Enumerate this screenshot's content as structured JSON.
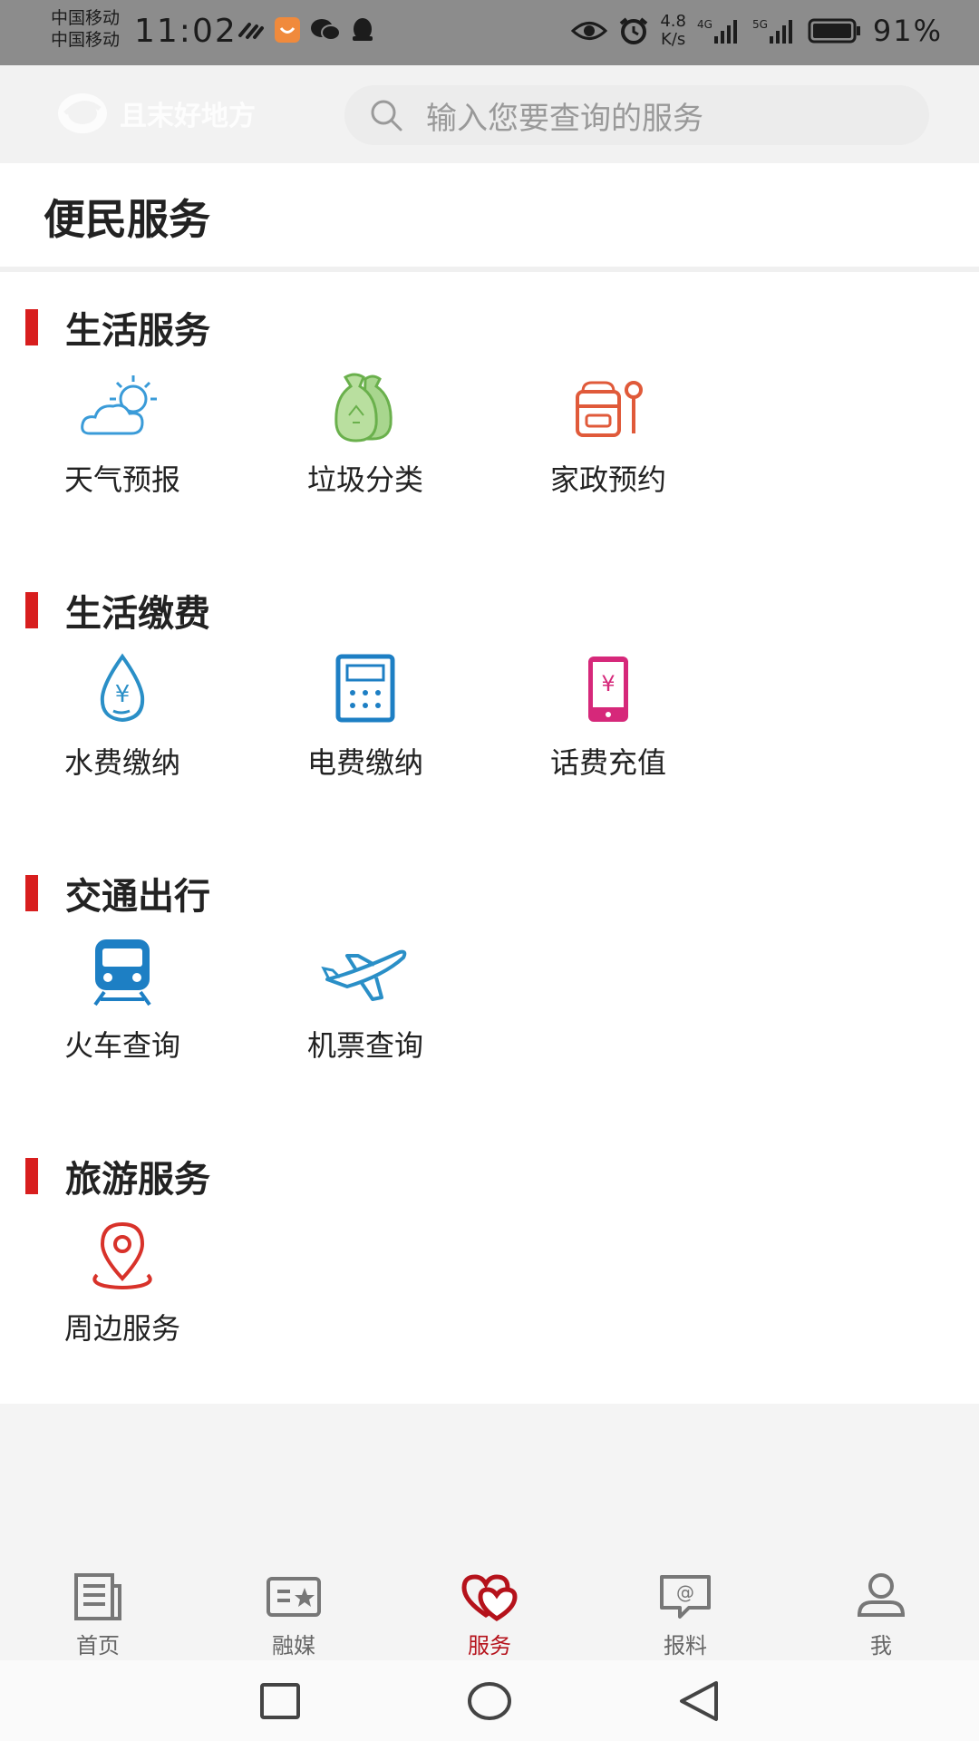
{
  "status": {
    "carrier1": "中国移动",
    "carrier2": "中国移动",
    "time": "11:02",
    "speed_value": "4.8",
    "speed_unit": "K/s",
    "net1": "4G",
    "net2": "5G",
    "battery": "91%"
  },
  "header": {
    "brand": "且末好地方",
    "search_placeholder": "输入您要查询的服务"
  },
  "page": {
    "title": "便民服务"
  },
  "sections": [
    {
      "title": "生活服务",
      "items": [
        {
          "label": "天气预报",
          "icon": "weather-icon"
        },
        {
          "label": "垃圾分类",
          "icon": "garbage-icon"
        },
        {
          "label": "家政预约",
          "icon": "housekeeping-icon"
        }
      ]
    },
    {
      "title": "生活缴费",
      "items": [
        {
          "label": "水费缴纳",
          "icon": "water-fee-icon"
        },
        {
          "label": "电费缴纳",
          "icon": "electricity-fee-icon"
        },
        {
          "label": "话费充值",
          "icon": "phone-recharge-icon"
        }
      ]
    },
    {
      "title": "交通出行",
      "items": [
        {
          "label": "火车查询",
          "icon": "train-icon"
        },
        {
          "label": "机票查询",
          "icon": "airplane-icon"
        }
      ]
    },
    {
      "title": "旅游服务",
      "items": [
        {
          "label": "周边服务",
          "icon": "location-pin-icon"
        }
      ]
    }
  ],
  "tabs": [
    {
      "label": "首页",
      "icon": "news-icon"
    },
    {
      "label": "融媒",
      "icon": "media-icon"
    },
    {
      "label": "服务",
      "icon": "hearts-icon",
      "active": true
    },
    {
      "label": "报料",
      "icon": "report-icon"
    },
    {
      "label": "我",
      "icon": "user-icon"
    }
  ],
  "colors": {
    "accent": "#b5121b",
    "section_bar": "#d81e1e"
  }
}
